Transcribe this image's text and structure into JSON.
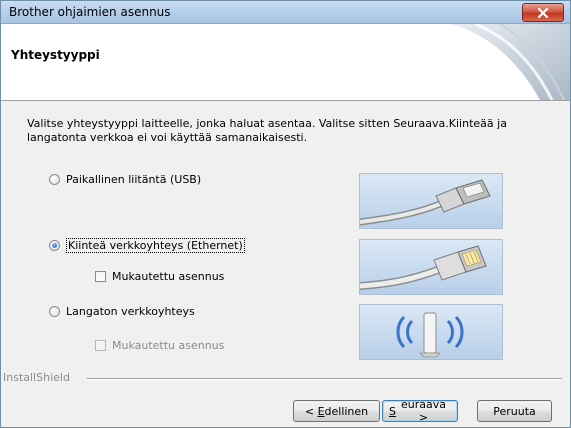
{
  "window": {
    "title": "Brother ohjaimien asennus"
  },
  "header": {
    "heading": "Yhteystyyppi"
  },
  "instruction": "Valitse yhteystyyppi laitteelle, jonka haluat asentaa. Valitse sitten Seuraava.Kiinteää ja langatonta verkkoa ei voi käyttää samanaikaisesti.",
  "options": [
    {
      "label": "Paikallinen liitäntä (USB)",
      "selected": false
    },
    {
      "label": "Kiinteä verkkoyhteys (Ethernet)",
      "selected": true
    },
    {
      "label": "Langaton verkkoyhteys",
      "selected": false
    }
  ],
  "custom_install": {
    "wired_label": "Mukautettu asennus",
    "wireless_label": "Mukautettu asennus"
  },
  "installshield": "InstallShield",
  "buttons": {
    "back_prefix": "< ",
    "back_key": "E",
    "back_rest": "dellinen",
    "next_key": "S",
    "next_rest": "euraava >",
    "cancel": "Peruuta"
  },
  "icons": {
    "close": "close-icon",
    "usb": "usb-cable-icon",
    "ethernet": "ethernet-cable-icon",
    "wireless": "wireless-router-icon"
  },
  "colors": {
    "close_button": "#c2351e",
    "selected_radio": "#1558b0",
    "panel_blue": "#b8cfe9",
    "wireless_blue": "#3a74c9"
  }
}
